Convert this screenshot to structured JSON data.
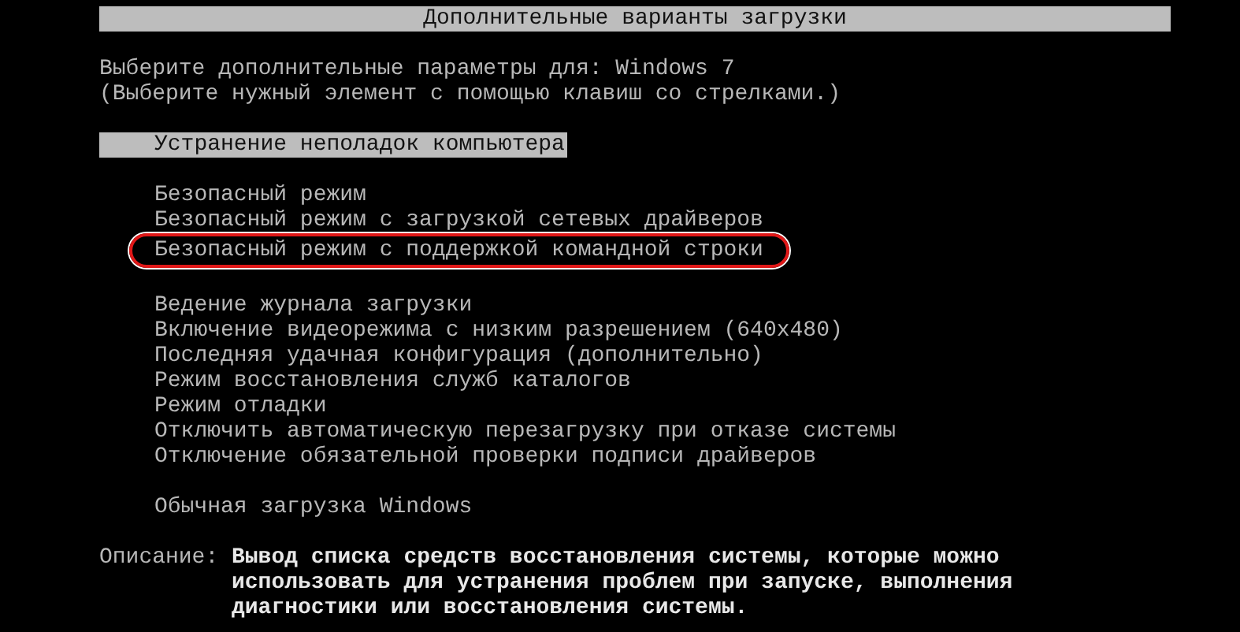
{
  "title": "Дополнительные варианты загрузки",
  "prompt": [
    "Выберите дополнительные параметры для: Windows 7",
    "(Выберите нужный элемент с помощью клавиш со стрелками.)"
  ],
  "menu_groups": [
    [
      {
        "label": "Устранение неполадок компьютера",
        "selected": true,
        "circled": false
      }
    ],
    [
      {
        "label": "Безопасный режим",
        "selected": false,
        "circled": false
      },
      {
        "label": "Безопасный режим с загрузкой сетевых драйверов",
        "selected": false,
        "circled": false
      },
      {
        "label": "Безопасный режим с поддержкой командной строки",
        "selected": false,
        "circled": true
      }
    ],
    [
      {
        "label": "Ведение журнала загрузки",
        "selected": false,
        "circled": false
      },
      {
        "label": "Включение видеорежима с низким разрешением (640x480)",
        "selected": false,
        "circled": false
      },
      {
        "label": "Последняя удачная конфигурация (дополнительно)",
        "selected": false,
        "circled": false
      },
      {
        "label": "Режим восстановления служб каталогов",
        "selected": false,
        "circled": false
      },
      {
        "label": "Режим отладки",
        "selected": false,
        "circled": false
      },
      {
        "label": "Отключить автоматическую перезагрузку при отказе системы",
        "selected": false,
        "circled": false
      },
      {
        "label": "Отключение обязательной проверки подписи драйверов",
        "selected": false,
        "circled": false
      }
    ],
    [
      {
        "label": "Обычная загрузка Windows",
        "selected": false,
        "circled": false
      }
    ]
  ],
  "description": {
    "label": "Описание:",
    "lines": [
      "Вывод списка средств восстановления системы, которые можно",
      "использовать для устранения проблем при запуске, выполнения",
      "диагностики или восстановления системы."
    ]
  }
}
